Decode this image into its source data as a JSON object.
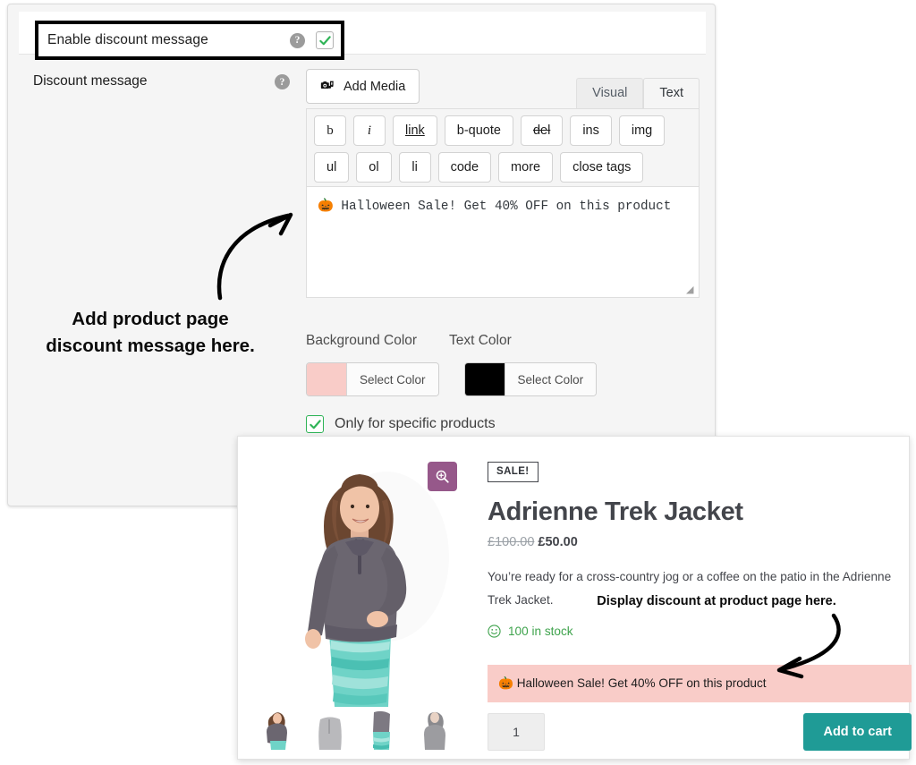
{
  "settings": {
    "enable_row": {
      "label": "Enable discount message",
      "help_icon": "help-circle-icon",
      "checked": true
    },
    "message_row": {
      "label": "Discount message",
      "help_icon": "help-circle-icon"
    },
    "editor": {
      "add_media_label": "Add Media",
      "add_media_icon": "media-camera-note-icon",
      "tabs": [
        {
          "label": "Visual",
          "active": false
        },
        {
          "label": "Text",
          "active": true
        }
      ],
      "toolbar_row1": [
        "b",
        "i",
        "link",
        "b-quote",
        "del",
        "ins",
        "img"
      ],
      "toolbar_row2": [
        "ul",
        "ol",
        "li",
        "code",
        "more",
        "close tags"
      ],
      "textarea_value": "🎃 Halloween Sale! Get 40% OFF on this product",
      "resize_grip_icon": "resize-grip-icon"
    },
    "colors": {
      "background_heading": "Background Color",
      "text_heading": "Text Color",
      "select_color_label": "Select Color",
      "background_value": "#f9ccc8",
      "text_value": "#000000"
    },
    "only_specific": {
      "label": "Only for specific products",
      "checked": true
    }
  },
  "annotations": {
    "left": "Add product page\ndiscount message here.",
    "left_line1": "Add product page",
    "left_line2": "discount message here.",
    "right": "Display discount at product page here.",
    "arrow_icon": "curved-arrow-icon"
  },
  "product": {
    "zoom_icon": "magnify-plus-icon",
    "sale_badge": "SALE!",
    "title": "Adrienne Trek Jacket",
    "price_old": "£100.00",
    "price_new": "£50.00",
    "description": "You’re ready for a cross-country jog or a coffee on the patio in the Adrienne Trek Jacket.",
    "stock_icon": "smiley-face-icon",
    "stock": "100 in stock",
    "discount_banner": "🎃 Halloween Sale! Get 40% OFF on this product",
    "discount_banner_bg": "#f9ccc8",
    "quantity": "1",
    "add_to_cart_label": "Add to cart",
    "add_to_cart_color": "#1f9b96",
    "thumbnail_count": 4
  }
}
